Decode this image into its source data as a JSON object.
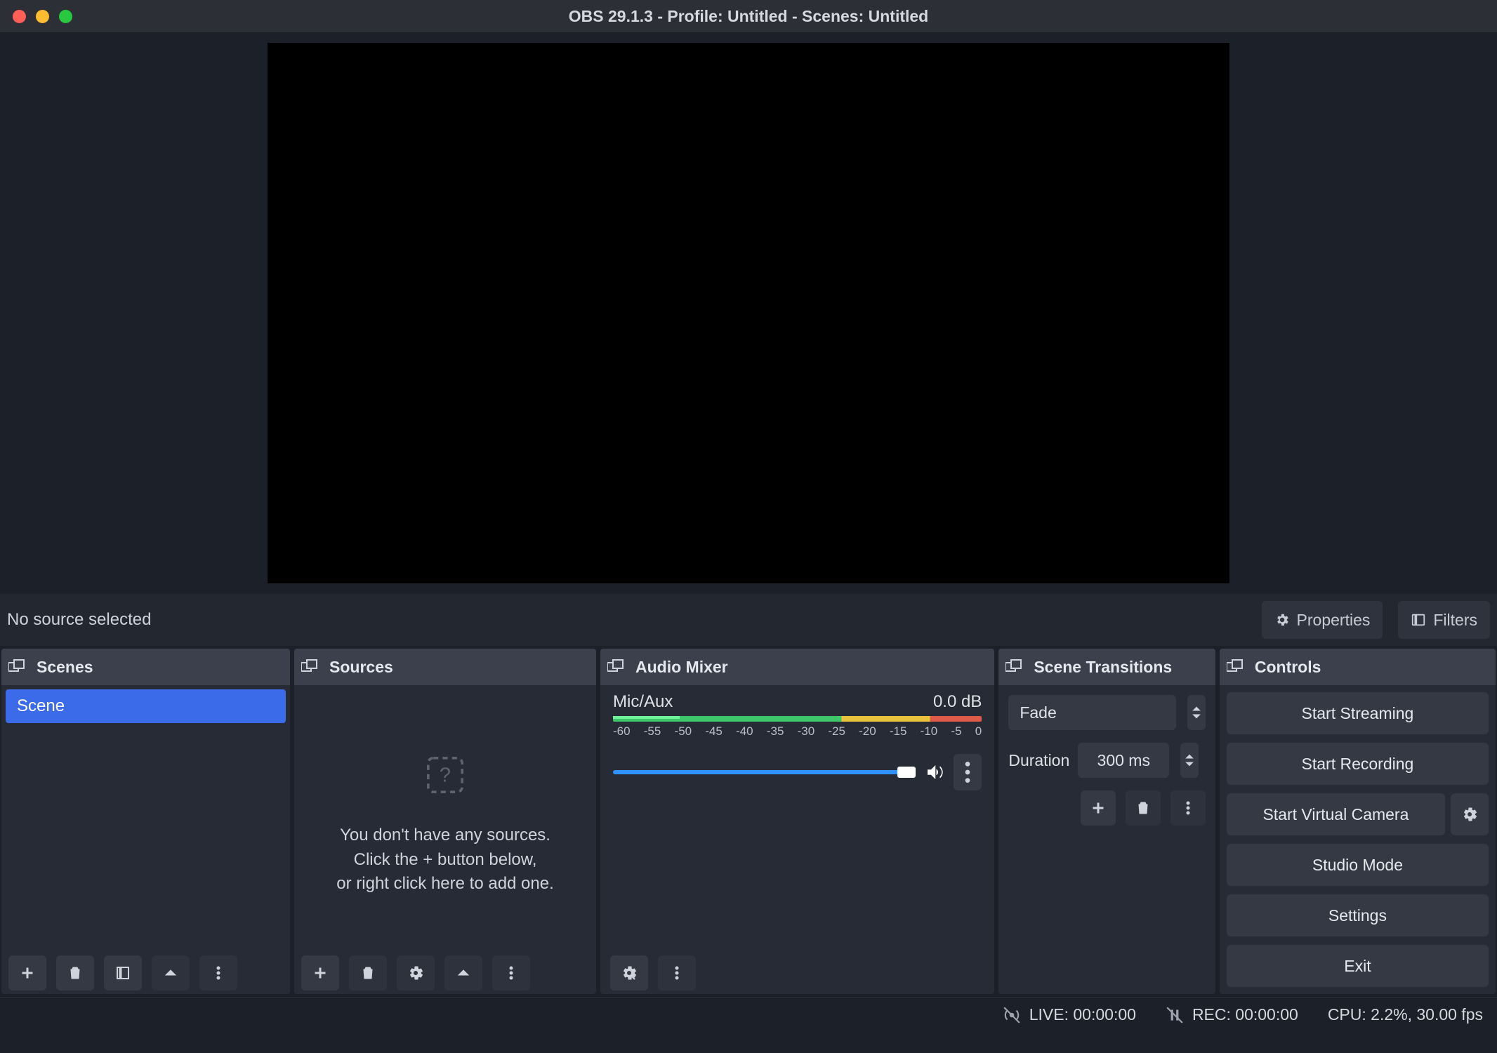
{
  "titlebar": {
    "title": "OBS 29.1.3 - Profile: Untitled - Scenes: Untitled"
  },
  "src_toolbar": {
    "selection_msg": "No source selected",
    "properties_label": "Properties",
    "filters_label": "Filters"
  },
  "docks": {
    "scenes": {
      "title": "Scenes",
      "items": [
        "Scene"
      ]
    },
    "sources": {
      "title": "Sources",
      "empty_line1": "You don't have any sources.",
      "empty_line2": "Click the + button below,",
      "empty_line3": "or right click here to add one."
    },
    "mixer": {
      "title": "Audio Mixer",
      "channel_name": "Mic/Aux",
      "channel_level": "0.0 dB",
      "scale": [
        "-60",
        "-55",
        "-50",
        "-45",
        "-40",
        "-35",
        "-30",
        "-25",
        "-20",
        "-15",
        "-10",
        "-5",
        "0"
      ]
    },
    "transitions": {
      "title": "Scene Transitions",
      "selected": "Fade",
      "duration_label": "Duration",
      "duration_value": "300 ms"
    },
    "controls": {
      "title": "Controls",
      "start_streaming": "Start Streaming",
      "start_recording": "Start Recording",
      "start_virtual_camera": "Start Virtual Camera",
      "studio_mode": "Studio Mode",
      "settings": "Settings",
      "exit": "Exit"
    }
  },
  "statusbar": {
    "live": "LIVE: 00:00:00",
    "rec": "REC: 00:00:00",
    "cpu": "CPU: 2.2%, 30.00 fps"
  }
}
